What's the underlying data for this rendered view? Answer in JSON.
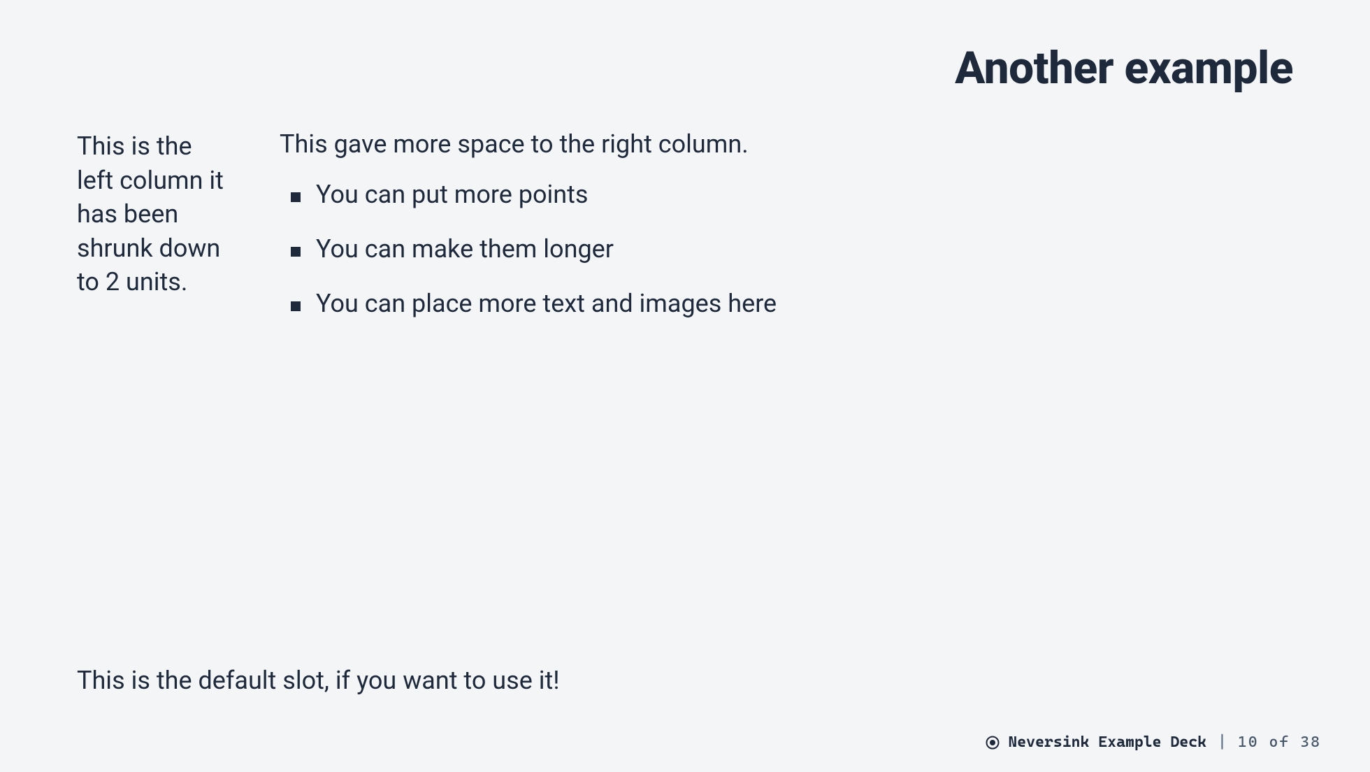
{
  "slide": {
    "title": "Another example",
    "left_column": "This is the left column it has been shrunk down to 2 units.",
    "right_column": {
      "intro": "This gave more space to the right column.",
      "bullets": [
        "You can put more points",
        "You can make them longer",
        "You can place more text and images here"
      ]
    },
    "default_slot": "This is the default slot, if you want to use it!"
  },
  "footer": {
    "deck_name": "Neversink Example Deck",
    "separator": "|",
    "page_current": 10,
    "page_total": 38,
    "page_of": "of"
  }
}
